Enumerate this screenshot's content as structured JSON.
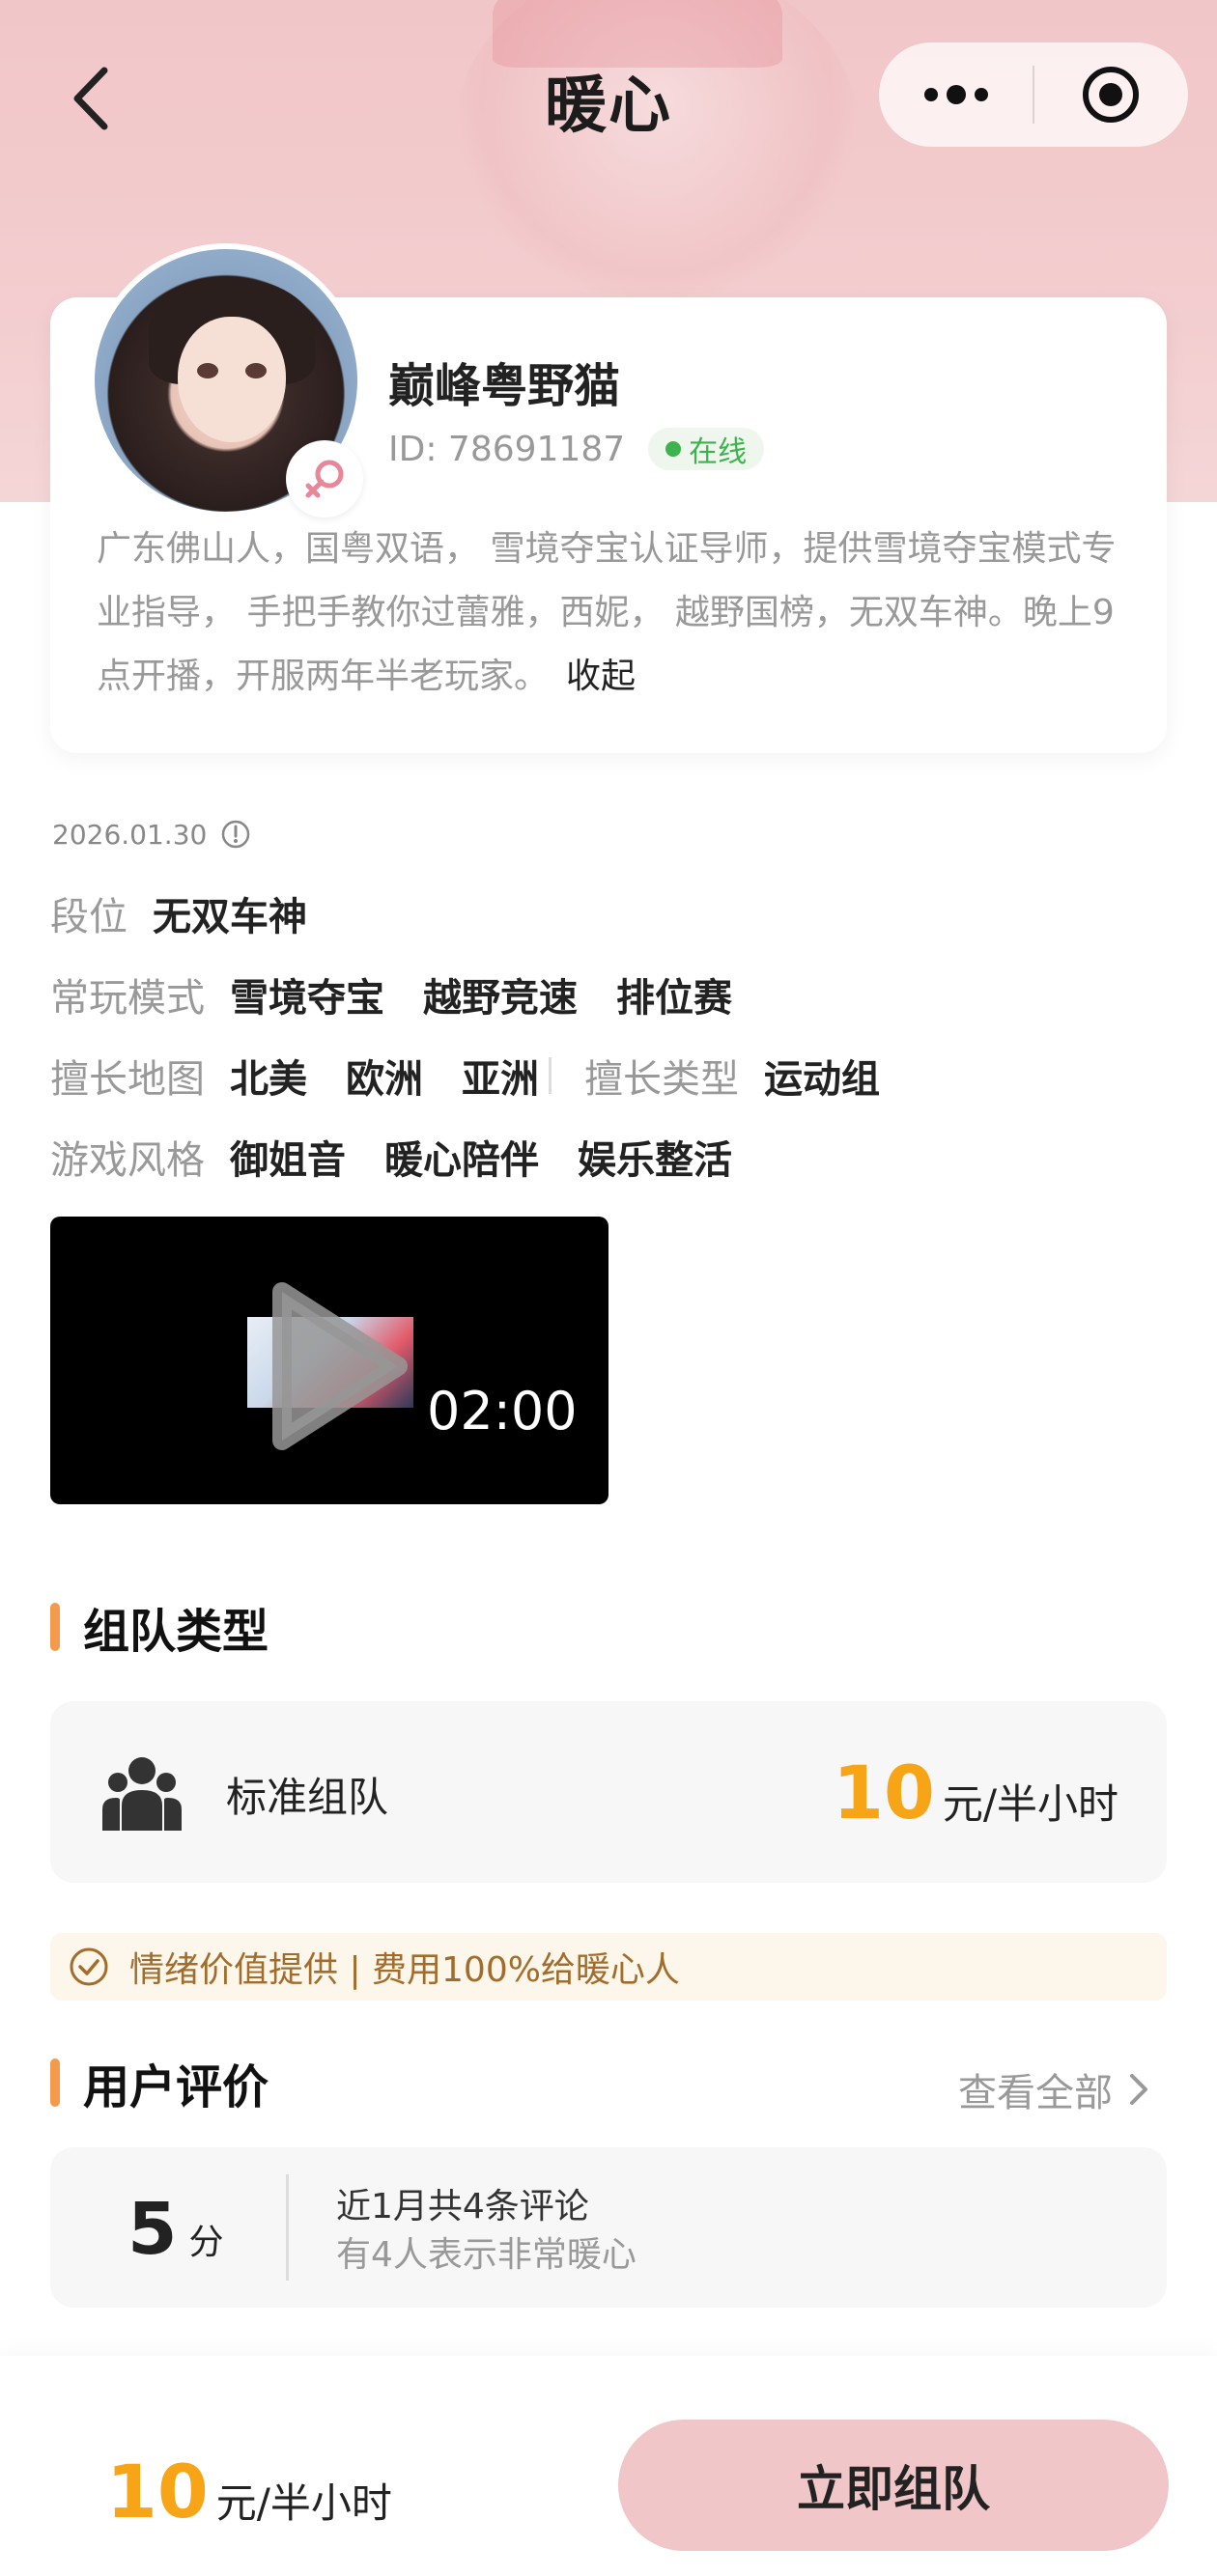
{
  "header": {
    "title": "暖心"
  },
  "profile": {
    "nickname": "巅峰粤野猫",
    "id_text": "ID: 78691187",
    "status": "在线",
    "bio": "广东佛山人，国粤双语， 雪境夺宝认证导师，提供雪境夺宝模式专业指导， 手把手教你过蕾雅，西妮， 越野国榜，无双车神。晚上9点开播，开服两年半老玩家。",
    "collapse_label": "收起"
  },
  "info": {
    "date": "2026.01.30",
    "rank": {
      "label": "段位",
      "values": [
        "无双车神"
      ]
    },
    "modes": {
      "label": "常玩模式",
      "values": [
        "雪境夺宝",
        "越野竞速",
        "排位赛"
      ]
    },
    "maps": {
      "label": "擅长地图",
      "values": [
        "北美",
        "欧洲",
        "亚洲"
      ]
    },
    "types": {
      "label": "擅长类型",
      "values": [
        "运动组"
      ]
    },
    "styles": {
      "label": "游戏风格",
      "values": [
        "御姐音",
        "暖心陪伴",
        "娱乐整活"
      ]
    }
  },
  "video": {
    "duration": "02:00"
  },
  "team_section": {
    "title": "组队类型",
    "option_name": "标准组队",
    "price": "10",
    "unit": "元/半小时"
  },
  "notice": {
    "text": "情绪价值提供 | 费用100%给暖心人"
  },
  "reviews": {
    "title": "用户评价",
    "view_all": "查看全部",
    "score": "5",
    "score_unit": "分",
    "line1": "近1月共4条评论",
    "line2": "有4人表示非常暖心"
  },
  "bottom": {
    "price": "10",
    "unit": "元/半小时",
    "cta": "立即组队"
  },
  "colors": {
    "accent_orange": "#f8a417",
    "section_bar": "#f49a4c",
    "cta_bg": "#f1c6c8",
    "online_green": "#3cb44b",
    "notice_text": "#a26d2c"
  },
  "icons": {
    "back": "chevron-left-icon",
    "more": "more-dots-icon",
    "target": "target-icon",
    "gender": "female-icon",
    "info": "info-circle-icon",
    "play": "play-icon",
    "team": "group-icon",
    "check": "check-circle-icon",
    "arrow": "chevron-right-icon"
  }
}
